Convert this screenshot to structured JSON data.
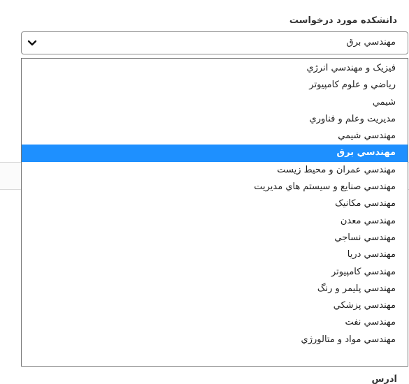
{
  "field": {
    "label": "دانشكده مورد درخواست",
    "selected_value": "مهندسي برق"
  },
  "icons": {
    "chevron": "chevron-down-icon"
  },
  "colors": {
    "highlight": "#1e90ff",
    "border": "#767676"
  },
  "dropdown": {
    "options": [
      {
        "label": "فيزيک و مهندسي انرژي"
      },
      {
        "label": "رياضي و علوم کامپيوتر"
      },
      {
        "label": "شيمي"
      },
      {
        "label": "مديريت وعلم و فناوري"
      },
      {
        "label": "مهندسي شيمي"
      },
      {
        "label": "مهندسي برق",
        "selected": true
      },
      {
        "label": "مهندسي عمران و محيط زيست"
      },
      {
        "label": "مهندسي صنايع و سيستم هاي مديريت"
      },
      {
        "label": "مهندسي مکانيک"
      },
      {
        "label": "مهندسي معدن"
      },
      {
        "label": "مهندسي نساجي"
      },
      {
        "label": "مهندسي دريا"
      },
      {
        "label": "مهندسي کامپيوتر"
      },
      {
        "label": "مهندسي پليمر و رنگ"
      },
      {
        "label": "مهندسي پزشکي"
      },
      {
        "label": "مهندسي نفت"
      },
      {
        "label": "مهندسي مواد و متالورژي"
      }
    ]
  },
  "bottom": {
    "partial_label": "آدرس"
  }
}
